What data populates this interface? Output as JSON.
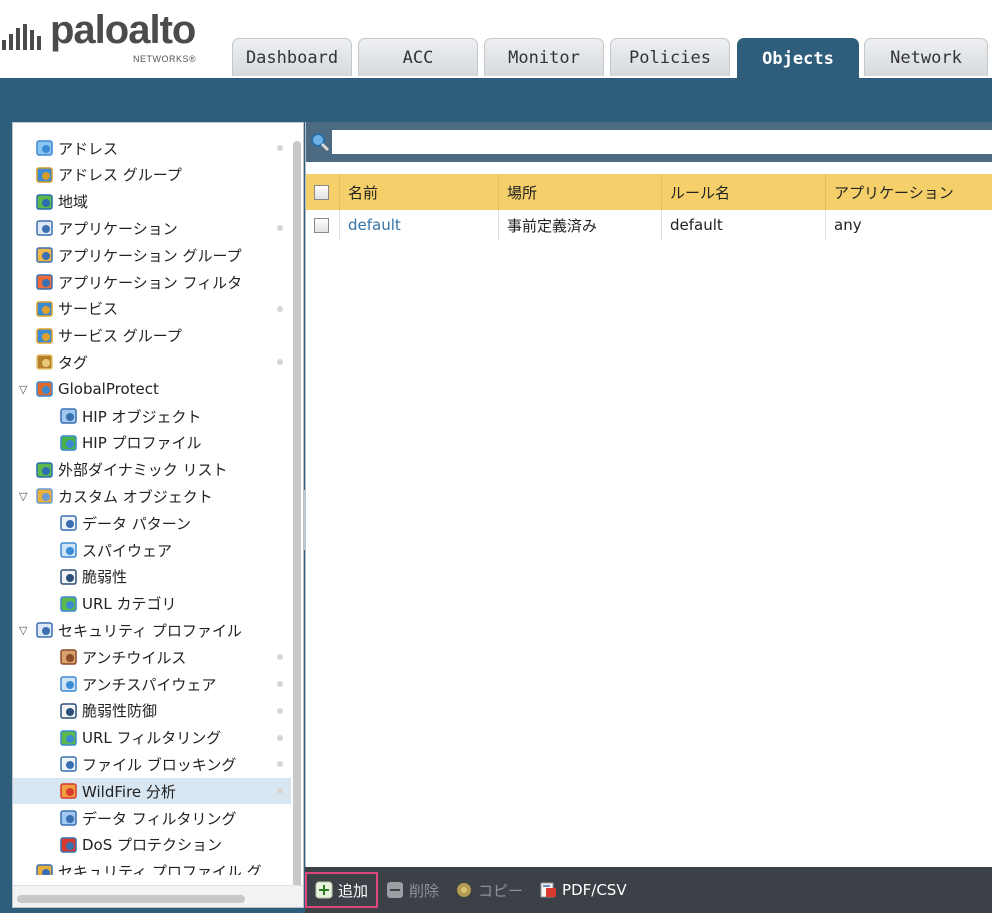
{
  "brand": {
    "name": "paloalto",
    "sub": "NETWORKS®"
  },
  "tabs": [
    {
      "label": "Dashboard",
      "active": false
    },
    {
      "label": "ACC",
      "active": false
    },
    {
      "label": "Monitor",
      "active": false
    },
    {
      "label": "Policies",
      "active": false
    },
    {
      "label": "Objects",
      "active": true
    },
    {
      "label": "Network",
      "active": false
    }
  ],
  "tree": [
    {
      "label": "アドレス",
      "icon": "address-icon",
      "indent": 0,
      "dot": true
    },
    {
      "label": "アドレス グループ",
      "icon": "address-group-icon",
      "indent": 0,
      "dot": false
    },
    {
      "label": "地域",
      "icon": "globe-icon",
      "indent": 0,
      "dot": false
    },
    {
      "label": "アプリケーション",
      "icon": "application-icon",
      "indent": 0,
      "dot": true
    },
    {
      "label": "アプリケーション グループ",
      "icon": "application-group-icon",
      "indent": 0,
      "dot": false
    },
    {
      "label": "アプリケーション フィルタ",
      "icon": "application-filter-icon",
      "indent": 0,
      "dot": false
    },
    {
      "label": "サービス",
      "icon": "service-icon",
      "indent": 0,
      "dot": true
    },
    {
      "label": "サービス グループ",
      "icon": "service-group-icon",
      "indent": 0,
      "dot": false
    },
    {
      "label": "タグ",
      "icon": "tag-icon",
      "indent": 0,
      "dot": true
    },
    {
      "label": "GlobalProtect",
      "icon": "globalprotect-icon",
      "indent": 0,
      "dot": false,
      "expander": "▽"
    },
    {
      "label": "HIP オブジェクト",
      "icon": "hip-object-icon",
      "indent": 1,
      "dot": false
    },
    {
      "label": "HIP プロファイル",
      "icon": "hip-profile-icon",
      "indent": 1,
      "dot": false
    },
    {
      "label": "外部ダイナミック リスト",
      "icon": "external-list-icon",
      "indent": 0,
      "dot": false
    },
    {
      "label": "カスタム オブジェクト",
      "icon": "custom-object-icon",
      "indent": 0,
      "dot": false,
      "expander": "▽"
    },
    {
      "label": "データ パターン",
      "icon": "data-pattern-icon",
      "indent": 1,
      "dot": false
    },
    {
      "label": "スパイウェア",
      "icon": "spyware-icon",
      "indent": 1,
      "dot": false
    },
    {
      "label": "脆弱性",
      "icon": "vulnerability-icon",
      "indent": 1,
      "dot": false
    },
    {
      "label": "URL カテゴリ",
      "icon": "url-category-icon",
      "indent": 1,
      "dot": false
    },
    {
      "label": "セキュリティ プロファイル",
      "icon": "security-profile-icon",
      "indent": 0,
      "dot": false,
      "expander": "▽"
    },
    {
      "label": "アンチウイルス",
      "icon": "antivirus-icon",
      "indent": 1,
      "dot": true
    },
    {
      "label": "アンチスパイウェア",
      "icon": "antispyware-icon",
      "indent": 1,
      "dot": true
    },
    {
      "label": "脆弱性防御",
      "icon": "vulnerability-protection-icon",
      "indent": 1,
      "dot": true
    },
    {
      "label": "URL フィルタリング",
      "icon": "url-filtering-icon",
      "indent": 1,
      "dot": true
    },
    {
      "label": "ファイル ブロッキング",
      "icon": "file-blocking-icon",
      "indent": 1,
      "dot": true
    },
    {
      "label": "WildFire 分析",
      "icon": "wildfire-icon",
      "indent": 1,
      "dot": true,
      "selected": true
    },
    {
      "label": "データ フィルタリング",
      "icon": "data-filtering-icon",
      "indent": 1,
      "dot": false
    },
    {
      "label": "DoS プロテクション",
      "icon": "dos-protection-icon",
      "indent": 1,
      "dot": false
    },
    {
      "label": "セキュリティ プロファイル グ",
      "icon": "security-profile-group-icon",
      "indent": 0,
      "dot": false
    }
  ],
  "search": {
    "placeholder": ""
  },
  "table": {
    "columns": [
      "名前",
      "場所",
      "ルール名",
      "アプリケーション"
    ],
    "rows": [
      {
        "name": "default",
        "location": "事前定義済み",
        "rule": "default",
        "application": "any"
      }
    ]
  },
  "toolbar": {
    "add": "追加",
    "delete": "削除",
    "copy": "コピー",
    "pdf": "PDF/CSV"
  },
  "colors": {
    "accent": "#2f5d7c",
    "header_row": "#f5d06a",
    "highlight": "#e0457b"
  }
}
